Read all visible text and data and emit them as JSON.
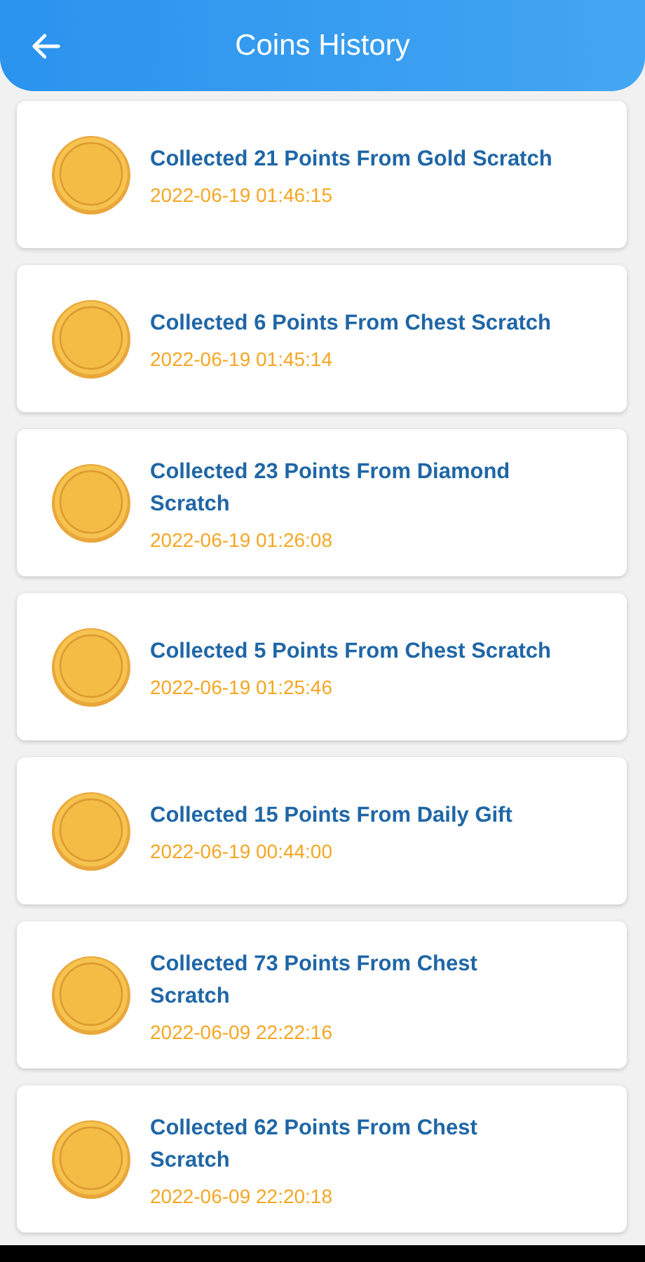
{
  "header": {
    "title": "Coins History"
  },
  "entries": [
    {
      "title": "Collected 21 Points From Gold Scratch",
      "time": "2022-06-19 01:46:15"
    },
    {
      "title": "Collected 6 Points From Chest Scratch",
      "time": "2022-06-19 01:45:14"
    },
    {
      "title": "Collected 23 Points From Diamond Scratch",
      "time": "2022-06-19 01:26:08"
    },
    {
      "title": "Collected 5 Points From Chest Scratch",
      "time": "2022-06-19 01:25:46"
    },
    {
      "title": "Collected 15 Points From Daily Gift",
      "time": "2022-06-19 00:44:00"
    },
    {
      "title": "Collected 73 Points From Chest Scratch",
      "time": "2022-06-09 22:22:16"
    },
    {
      "title": "Collected 62 Points From Chest Scratch",
      "time": "2022-06-09 22:20:18"
    }
  ]
}
